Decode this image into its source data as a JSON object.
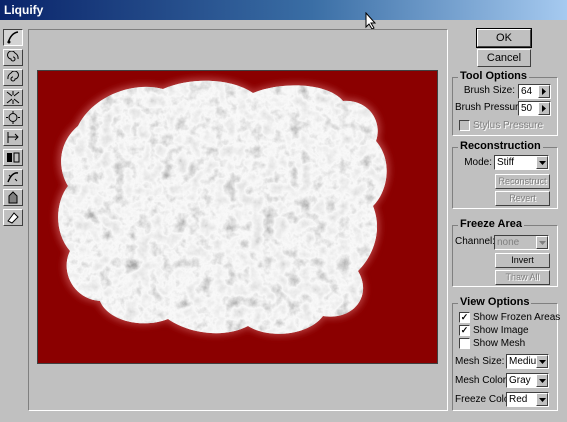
{
  "window": {
    "title": "Liquify"
  },
  "tools": [
    {
      "icon": "warp-brush-icon"
    },
    {
      "icon": "twirl-clockwise-icon"
    },
    {
      "icon": "twirl-counterclockwise-icon"
    },
    {
      "icon": "pucker-icon"
    },
    {
      "icon": "bloat-icon"
    },
    {
      "icon": "shift-pixels-icon"
    },
    {
      "icon": "reflection-icon"
    },
    {
      "icon": "reconstruct-tool-icon"
    },
    {
      "icon": "freeze-brush-icon"
    },
    {
      "icon": "thaw-brush-icon"
    }
  ],
  "buttons": {
    "ok": "OK",
    "cancel": "Cancel"
  },
  "tool_options": {
    "title": "Tool Options",
    "brush_size_label": "Brush Size:",
    "brush_size": "64",
    "brush_pressure_label": "Brush Pressure:",
    "brush_pressure": "50",
    "stylus_pressure_label": "Stylus Pressure",
    "stylus_pressure_checked": false
  },
  "reconstruction": {
    "title": "Reconstruction",
    "mode_label": "Mode:",
    "mode": "Stiff",
    "reconstruct_label": "Reconstruct",
    "revert_label": "Revert"
  },
  "freeze_area": {
    "title": "Freeze Area",
    "channel_label": "Channel:",
    "channel": "none",
    "invert_label": "Invert",
    "thaw_all_label": "Thaw All"
  },
  "view_options": {
    "title": "View Options",
    "show_frozen_label": "Show Frozen Areas",
    "show_frozen_checked": true,
    "show_image_label": "Show Image",
    "show_image_checked": true,
    "show_mesh_label": "Show Mesh",
    "show_mesh_checked": false,
    "mesh_size_label": "Mesh Size:",
    "mesh_size": "Medium",
    "mesh_color_label": "Mesh Color:",
    "mesh_color": "Gray",
    "freeze_color_label": "Freeze Color:",
    "freeze_color": "Red"
  },
  "colors": {
    "freeze_overlay": "#8b0000",
    "dialog_face": "#c0c0c0",
    "title_start": "#0a246a"
  }
}
